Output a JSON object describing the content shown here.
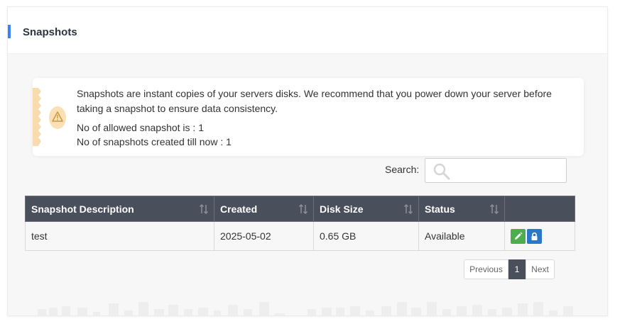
{
  "panel": {
    "title": "Snapshots",
    "accent_color": "#3b82f6"
  },
  "alert": {
    "icon": "warning-icon",
    "message": "Snapshots are instant copies of your servers disks. We recommend that you power down your server before taking a snapshot to ensure data consistency.",
    "allowed": "No of allowed snapshot is : 1",
    "created": "No of snapshots created till now : 1"
  },
  "search": {
    "label": "Search:",
    "value": "",
    "icon": "search-icon"
  },
  "table": {
    "columns": [
      "Snapshot Description",
      "Created",
      "Disk Size",
      "Status"
    ],
    "rows": [
      {
        "description": "test",
        "created": "2025-05-02",
        "disk_size": "0.65 GB",
        "status": "Available",
        "actions": [
          "edit-icon",
          "lock-icon"
        ]
      }
    ],
    "header_color": "#4a4f5c"
  },
  "pagination": {
    "previous": "Previous",
    "current": "1",
    "next": "Next"
  },
  "colors": {
    "edit_button": "#4cae4c",
    "lock_button": "#2c78c8",
    "warning": "#f5c77e"
  }
}
